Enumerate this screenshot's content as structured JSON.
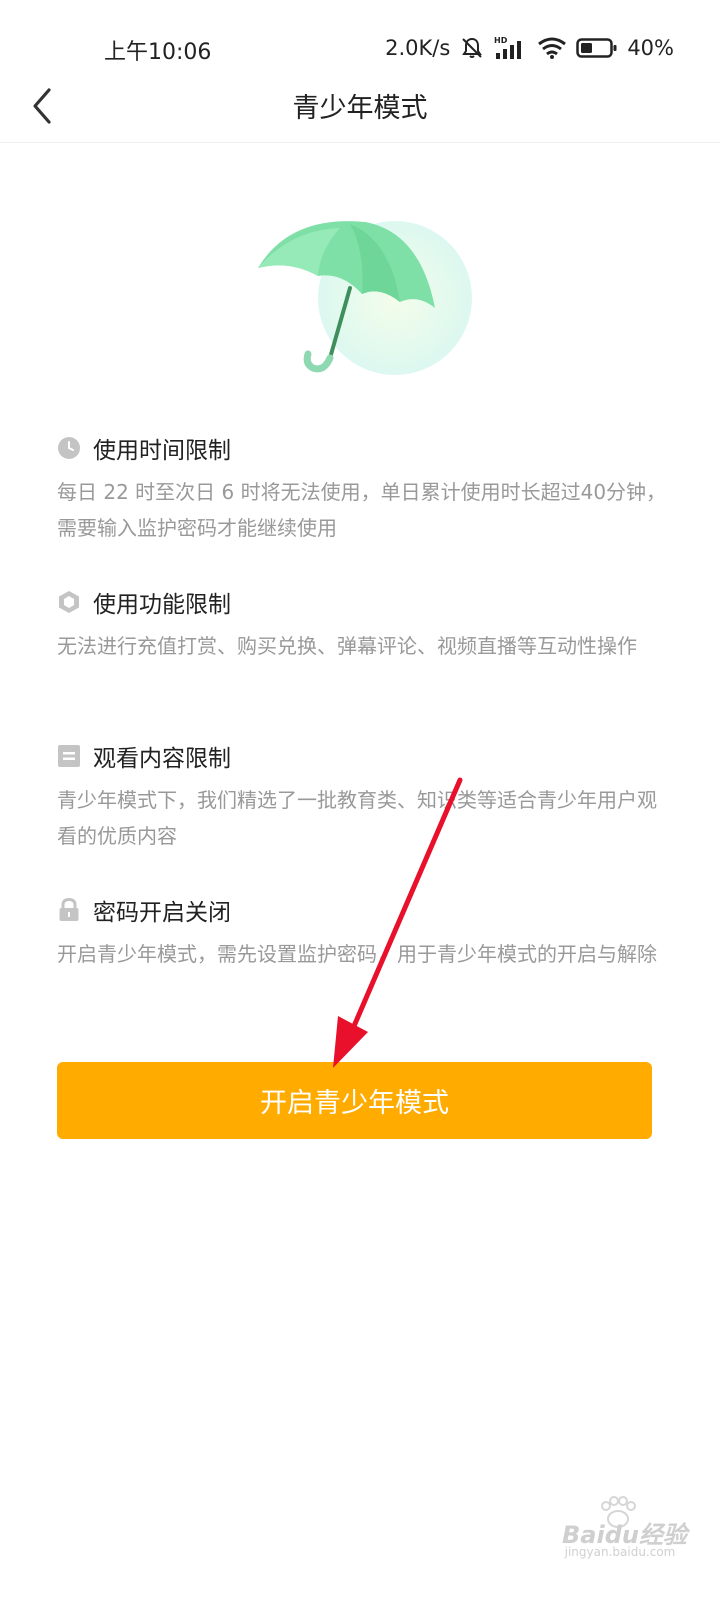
{
  "status_bar": {
    "time": "上午10:06",
    "network_speed": "2.0K/s",
    "battery": "40%",
    "icons": [
      "mute-bell-icon",
      "hd-signal-icon",
      "wifi-icon",
      "battery-icon"
    ]
  },
  "nav": {
    "title": "青少年模式",
    "back_icon": "chevron-left-icon"
  },
  "hero_icon": "umbrella-illustration",
  "sections": [
    {
      "icon": "clock-icon",
      "title": "使用时间限制",
      "desc": "每日 22 时至次日 6 时将无法使用，单日累计使用时长超过40分钟，需要输入监护密码才能继续使用"
    },
    {
      "icon": "hexagon-icon",
      "title": "使用功能限制",
      "desc": "无法进行充值打赏、购买兑换、弹幕评论、视频直播等互动性操作"
    },
    {
      "icon": "content-icon",
      "title": "观看内容限制",
      "desc": "青少年模式下，我们精选了一批教育类、知识类等适合青少年用户观看的优质内容"
    },
    {
      "icon": "lock-icon",
      "title": "密码开启关闭",
      "desc": "开启青少年模式，需先设置监护密码，用于青少年模式的开启与解除"
    }
  ],
  "primary_button": {
    "label": "开启青少年模式"
  },
  "watermark": {
    "brand": "Baidu经验",
    "url": "jingyan.baidu.com"
  },
  "colors": {
    "accent": "#ffab00",
    "umbrella": "#7ee0a6",
    "arrow": "#e8102a",
    "secondary_text": "#999999"
  }
}
